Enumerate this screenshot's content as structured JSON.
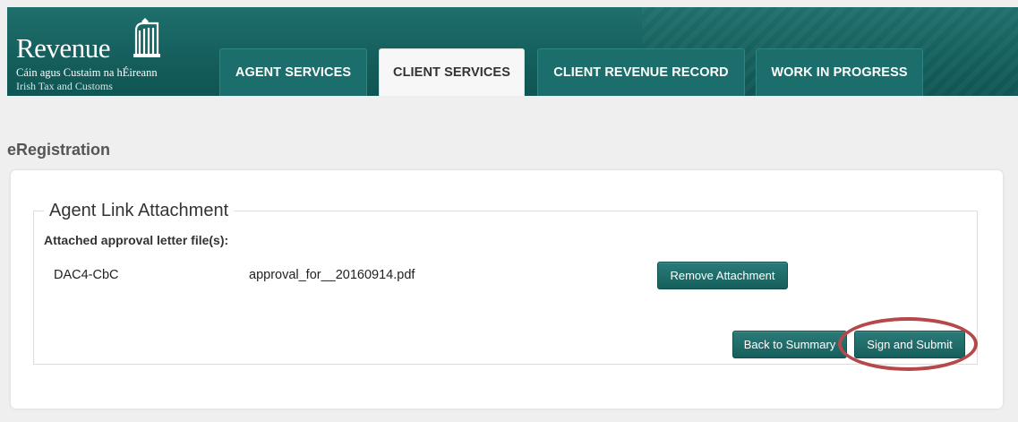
{
  "header": {
    "logo": {
      "name": "Revenue",
      "line1": "Cáin agus Custaim na hÉireann",
      "line2": "Irish Tax and Customs"
    },
    "tabs": [
      {
        "label": "AGENT SERVICES",
        "active": false
      },
      {
        "label": "CLIENT SERVICES",
        "active": true
      },
      {
        "label": "CLIENT REVENUE RECORD",
        "active": false
      },
      {
        "label": "WORK IN PROGRESS",
        "active": false
      }
    ]
  },
  "page": {
    "title": "eRegistration"
  },
  "panel": {
    "legend": "Agent Link Attachment",
    "subheading": "Attached approval letter file(s):",
    "attachment": {
      "code": "DAC4-CbC",
      "filename": "approval_for__20160914.pdf",
      "remove_label": "Remove Attachment"
    },
    "actions": {
      "back_label": "Back to Summary",
      "submit_label": "Sign and Submit"
    }
  },
  "colors": {
    "brand": "#175f5c",
    "highlight": "#b5484a"
  }
}
